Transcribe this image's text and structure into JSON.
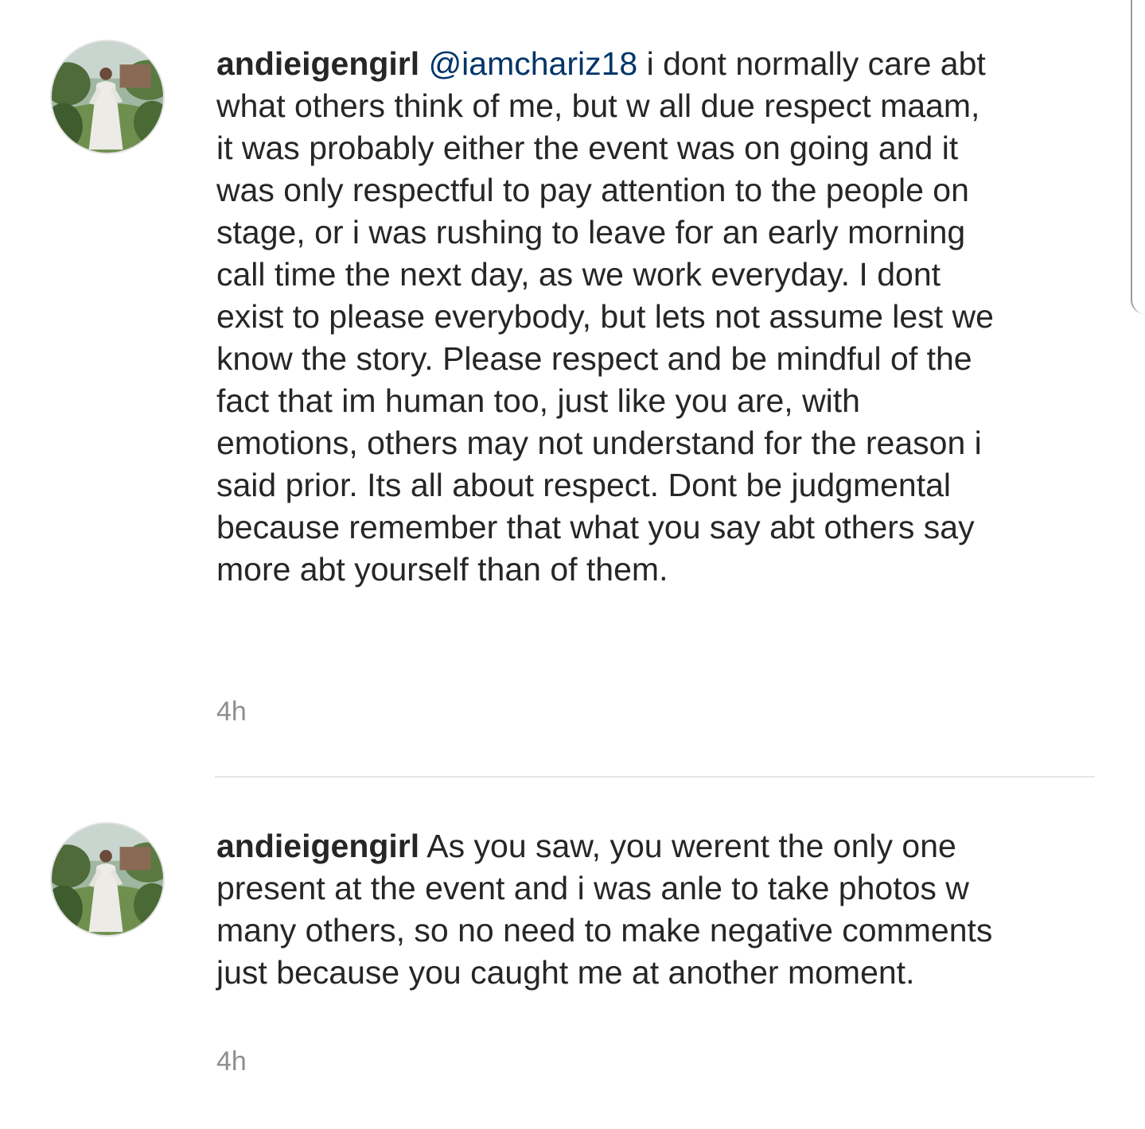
{
  "comments": [
    {
      "username": "andieigengirl",
      "mention": "@iamchariz18",
      "text": "i dont normally care abt what others think of me, but w all due respect maam, it was probably either the event was on going and it was only respectful to pay attention to the people on stage, or i was rushing to leave for an early morning call time the next day, as we work everyday. I dont exist to please everybody, but lets not assume lest we know the story. Please respect and be mindful of the fact that im human too, just like you are, with emotions, others may not understand for the reason i said prior. Its all about respect. Dont be judgmental because remember that what you say abt others say more abt yourself than of them.",
      "time": "4h"
    },
    {
      "username": "andieigengirl",
      "text": "As you saw, you werent the only one present at the event and i was anle to take photos w many others, so no need to make negative comments just because you caught me at another moment.",
      "time": "4h"
    }
  ],
  "colors": {
    "text": "#262626",
    "mention": "#003569",
    "timestamp": "#8e8e8e",
    "divider": "#e6e6e6"
  }
}
